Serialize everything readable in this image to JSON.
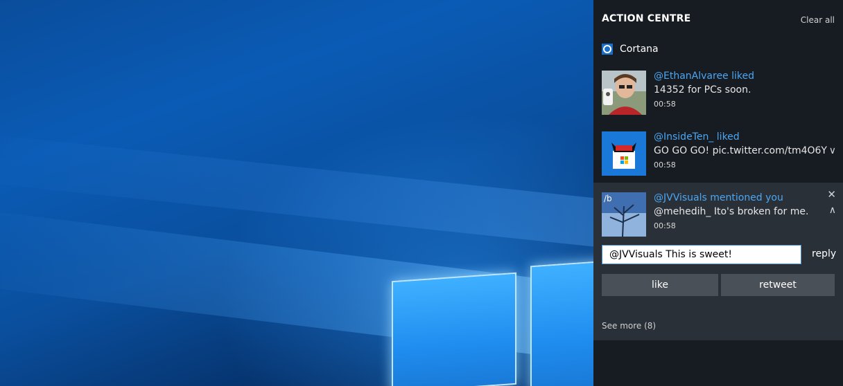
{
  "action_centre": {
    "title": "ACTION CENTRE",
    "clear_all": "Clear all",
    "group": {
      "label": "Cortana"
    },
    "notifications": [
      {
        "title": "@EthanAlvaree liked",
        "body": "14352 for PCs soon.",
        "time": "00:58"
      },
      {
        "title": "@InsideTen_ liked",
        "body": "GO GO GO! pic.twitter.com/tm4O6Y",
        "time": "00:58"
      },
      {
        "title": "@JVVisuals mentioned you",
        "body": "@mehedih_ Ito's broken for me.",
        "time": "00:58",
        "reply_value": "@JVVisuals This is sweet!",
        "reply_label": "reply",
        "like_label": "like",
        "retweet_label": "retweet",
        "see_more": "See more (8)"
      }
    ]
  },
  "colors": {
    "accent": "#4ca7f2",
    "panel": "#1c2128",
    "expanded": "#2a3038"
  }
}
